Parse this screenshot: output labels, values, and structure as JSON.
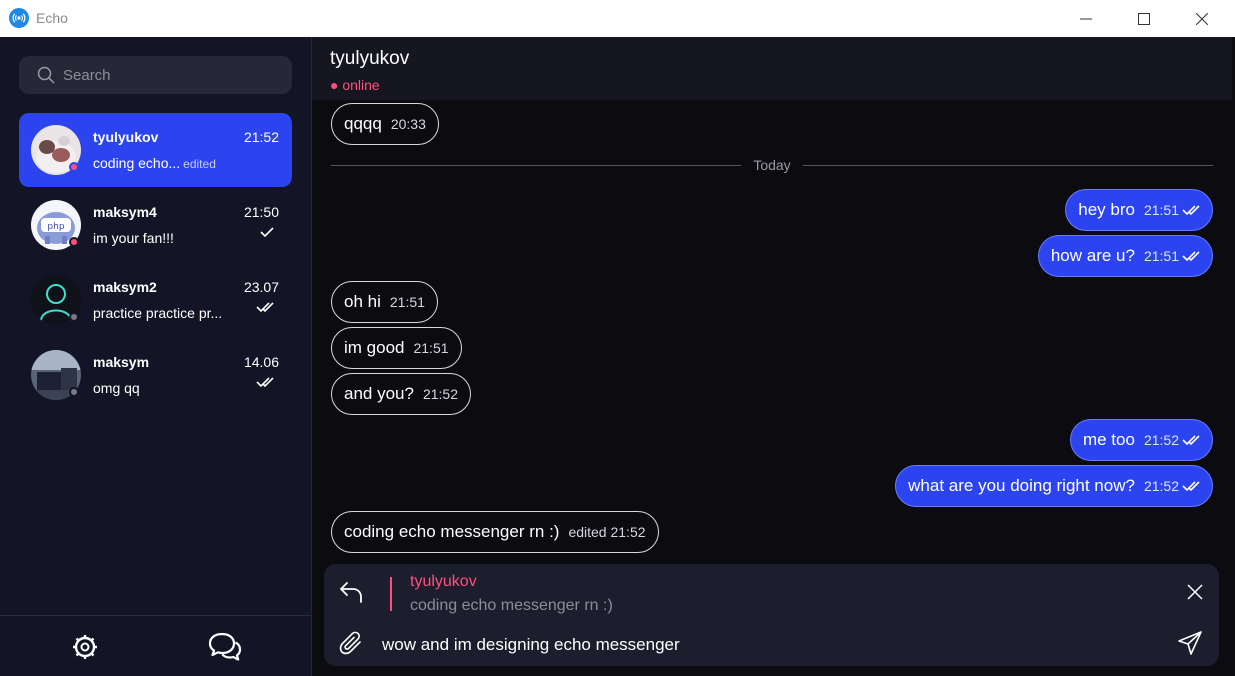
{
  "window": {
    "title": "Echo",
    "icons": [
      "broadcast-icon",
      "minimize-icon",
      "maximize-icon",
      "close-icon"
    ]
  },
  "sidebar": {
    "search": {
      "placeholder": "Search",
      "value": ""
    },
    "chats": [
      {
        "name": "tyulyukov",
        "time": "21:52",
        "preview": "coding echo...",
        "edited": "edited",
        "status": "online",
        "status_color": "#ff4f7a",
        "read_state": "none",
        "active": true
      },
      {
        "name": "maksym4",
        "time": "21:50",
        "preview": "im your fan!!!",
        "status": "online",
        "status_color": "#ff4f7a",
        "read_state": "sent"
      },
      {
        "name": "maksym2",
        "time": "23.07",
        "preview": "practice practice pr...",
        "status": "offline",
        "status_color": "#7a7a86",
        "read_state": "read"
      },
      {
        "name": "maksym",
        "time": "14.06",
        "preview": "omg qq",
        "status": "offline",
        "status_color": "#7a7a86",
        "read_state": "read"
      }
    ],
    "footer": {
      "icons": [
        "settings-icon",
        "chats-icon"
      ]
    }
  },
  "chat": {
    "header": {
      "name": "tyulyukov",
      "status": "● online"
    },
    "divider_label": "Today",
    "messages": [
      {
        "direction": "in",
        "text": "qqqq",
        "time": "20:33"
      },
      {
        "direction": "out",
        "text": "hey bro",
        "time": "21:51",
        "read": true
      },
      {
        "direction": "out",
        "text": "how are u?",
        "time": "21:51",
        "read": true
      },
      {
        "direction": "in",
        "text": "oh hi",
        "time": "21:51"
      },
      {
        "direction": "in",
        "text": "im good",
        "time": "21:51"
      },
      {
        "direction": "in",
        "text": "and you?",
        "time": "21:52"
      },
      {
        "direction": "out",
        "text": "me too",
        "time": "21:52",
        "read": true
      },
      {
        "direction": "out",
        "text": "what are you doing right now?",
        "time": "21:52",
        "read": true
      },
      {
        "direction": "in",
        "text": "coding echo messenger rn :)",
        "time": "edited 21:52"
      }
    ],
    "composer": {
      "reply_to_name": "tyulyukov",
      "reply_to_text": "coding echo messenger rn :)",
      "input_value": "wow and im designing echo messenger"
    }
  },
  "colors": {
    "accent": "#2b44f0",
    "online": "#ff4f7a",
    "sidebar_bg": "#131526",
    "chat_bg": "#0b0b10"
  }
}
